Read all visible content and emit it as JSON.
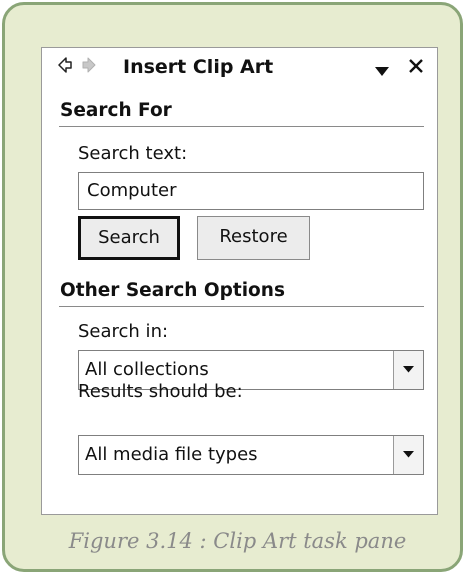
{
  "pane": {
    "title": "Insert Clip Art",
    "icons": {
      "back": "back-arrow-icon",
      "forward": "forward-arrow-icon",
      "menu": "dropdown-triangle-icon",
      "close": "close-icon"
    }
  },
  "search_for": {
    "header": "Search For",
    "search_text_label": "Search text:",
    "search_text_value": "Computer",
    "search_button": "Search",
    "restore_button": "Restore"
  },
  "other_options": {
    "header": "Other Search Options",
    "search_in_label": "Search in:",
    "search_in_value": "All collections",
    "results_label": "Results should be:",
    "results_value": "All media file types"
  },
  "caption": "Figure 3.14 : Clip Art task pane",
  "colors": {
    "frame_background": "#e7ecd0",
    "frame_border": "#8aa577",
    "caption_text": "#8a8a8a"
  }
}
